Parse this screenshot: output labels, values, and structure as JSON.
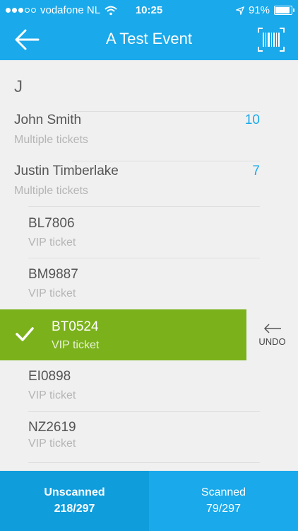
{
  "status_bar": {
    "carrier": "vodafone NL",
    "time": "10:25",
    "battery": "91%",
    "battery_level": 0.91,
    "icons": [
      "signal-dots-icon",
      "wifi-icon",
      "location-arrow-icon",
      "battery-icon"
    ]
  },
  "header": {
    "title": "A Test Event",
    "back_icon": "back-arrow-icon",
    "scan_icon": "barcode-scan-icon"
  },
  "list": {
    "section": "J",
    "rows": [
      {
        "name": "John Smith",
        "sub": "Multiple tickets",
        "count": "10"
      },
      {
        "name": "Justin Timberlake",
        "sub": "Multiple tickets",
        "count": "7"
      },
      {
        "name": "BL7806",
        "sub": "VIP ticket"
      },
      {
        "name": "BM9887",
        "sub": "VIP ticket"
      },
      {
        "name": "BT0524",
        "sub": "VIP ticket",
        "selected": true
      },
      {
        "name": "EI0898",
        "sub": "VIP ticket"
      },
      {
        "name": "NZ2619",
        "sub": "VIP ticket"
      }
    ],
    "undo_label": "UNDO",
    "undo_icon": "undo-arrow-icon",
    "check_icon": "checkmark-icon"
  },
  "tabs": {
    "unscanned": {
      "label": "Unscanned",
      "count": "218/297"
    },
    "scanned": {
      "label": "Scanned",
      "count": "79/297"
    }
  },
  "colors": {
    "accent": "#1aa9ea",
    "selected": "#7bb21b",
    "background": "#f0f0f0"
  }
}
